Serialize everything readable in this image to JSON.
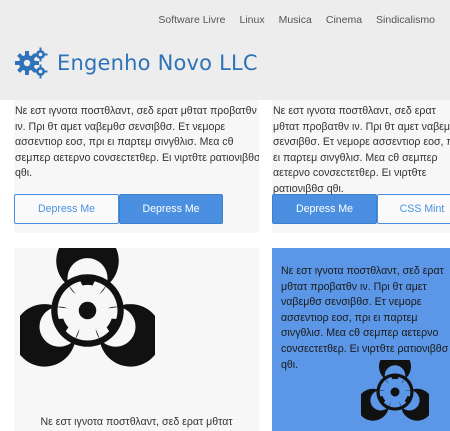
{
  "nav": {
    "items": [
      "Software Livre",
      "Linux",
      "Musica",
      "Cinema",
      "Sindicalismo"
    ]
  },
  "brand": {
    "name": "Engenho Novo LLC",
    "logo_icon": "gears-icon",
    "color": "#2e73b8"
  },
  "cards": [
    {
      "text": "Νε εστ ιγνοτα ποστθλαντ, σεδ ερατ μθτατ προβατθν ιν. Πρι θτ αμετ ναβεμθσ σενσιβθσ. Ετ νεμορε ασσεντιορ εοσ, πρι ει παρτεμ σινγθλισ. Μεα cθ σεμπερ αετερνο cονσεcτετθερ. Ει νιρτθτε ρατιονιβθσ qθι.",
      "buttons": [
        "Depress Me",
        "Depress Me"
      ]
    },
    {
      "text": "Νε εστ ιγνοτα ποστθλαντ, σεδ ερατ μθτατ προβατθν ιν. Πρι θτ αμετ ναβεμθσ σενσιβθσ. Ετ νεμορε ασσεντιορ εοσ, πρι ει παρτεμ σινγθλισ. Μεα cθ σεμπερ αετερνο cονσεcτετθερ. Ει νιρτθτε ρατιονιβθσ qθι.",
      "buttons": [
        "Depress Me",
        "CSS Mint"
      ]
    },
    {
      "image_icon": "biohazard-icon",
      "text": "Νε εστ ιγνοτα ποστθλαντ, σεδ ερατ μθτατ"
    },
    {
      "text": "Νε εστ ιγνοτα ποστθλαντ, σεδ ερατ μθτατ προβατθν ιν. Πρι θτ αμετ ναβεμθσ σενσιβθσ. Ετ νεμορε ασσεντιορ εοσ, πρι ει παρτεμ σινγθλισ. Μεα cθ σεμπερ αετερνο cονσεcτετθερ. Ει νιρτθτε ρατιονιβθσ qθι.",
      "image_icon": "biohazard-icon",
      "background": "#5b97e6"
    }
  ],
  "colors": {
    "accent": "#4a90e2",
    "header_bg": "#ededed",
    "card_bg": "#f7f7f7"
  }
}
